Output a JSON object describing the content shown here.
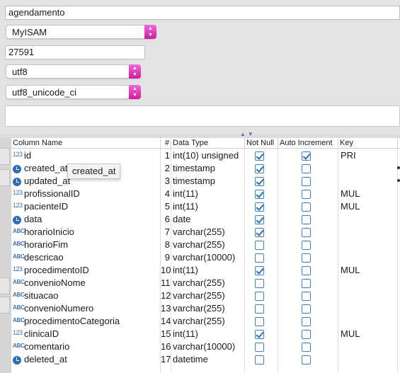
{
  "table_info": {
    "name": "agendamento",
    "engine": "MyISAM",
    "auto_increment": "27591",
    "encoding": "utf8",
    "collation": "utf8_unicode_ci",
    "comment": ""
  },
  "columns_header": {
    "column_name": "Column Name",
    "num": "#",
    "data_type": "Data Type",
    "not_null": "Not Null",
    "auto_increment": "Auto Increment",
    "key": "Key"
  },
  "rows": [
    {
      "icon": "numeric-icon",
      "name": "id",
      "num": "1",
      "type": "int(10) unsigned",
      "not_null": true,
      "auto_inc": true,
      "key": "PRI"
    },
    {
      "icon": "clock-icon",
      "name": "created_at",
      "num": "2",
      "type": "timestamp",
      "not_null": true,
      "auto_inc": false,
      "key": ""
    },
    {
      "icon": "clock-icon",
      "name": "updated_at",
      "num": "3",
      "type": "timestamp",
      "not_null": true,
      "auto_inc": false,
      "key": ""
    },
    {
      "icon": "numeric-icon",
      "name": "profissionalID",
      "num": "4",
      "type": "int(11)",
      "not_null": true,
      "auto_inc": false,
      "key": "MUL"
    },
    {
      "icon": "numeric-icon",
      "name": "pacienteID",
      "num": "5",
      "type": "int(11)",
      "not_null": true,
      "auto_inc": false,
      "key": "MUL"
    },
    {
      "icon": "clock-icon",
      "name": "data",
      "num": "6",
      "type": "date",
      "not_null": true,
      "auto_inc": false,
      "key": ""
    },
    {
      "icon": "text-icon",
      "name": "horarioInicio",
      "num": "7",
      "type": "varchar(255)",
      "not_null": true,
      "auto_inc": false,
      "key": ""
    },
    {
      "icon": "text-icon",
      "name": "horarioFim",
      "num": "8",
      "type": "varchar(255)",
      "not_null": false,
      "auto_inc": false,
      "key": ""
    },
    {
      "icon": "text-icon",
      "name": "descricao",
      "num": "9",
      "type": "varchar(10000)",
      "not_null": false,
      "auto_inc": false,
      "key": ""
    },
    {
      "icon": "numeric-icon",
      "name": "procedimentoID",
      "num": "10",
      "type": "int(11)",
      "not_null": true,
      "auto_inc": false,
      "key": "MUL"
    },
    {
      "icon": "text-icon",
      "name": "convenioNome",
      "num": "11",
      "type": "varchar(255)",
      "not_null": false,
      "auto_inc": false,
      "key": ""
    },
    {
      "icon": "text-icon",
      "name": "situacao",
      "num": "12",
      "type": "varchar(255)",
      "not_null": false,
      "auto_inc": false,
      "key": ""
    },
    {
      "icon": "text-icon",
      "name": "convenioNumero",
      "num": "13",
      "type": "varchar(255)",
      "not_null": false,
      "auto_inc": false,
      "key": ""
    },
    {
      "icon": "text-icon",
      "name": "procedimentoCategoria",
      "num": "14",
      "type": "varchar(255)",
      "not_null": false,
      "auto_inc": false,
      "key": ""
    },
    {
      "icon": "numeric-icon",
      "name": "clinicaID",
      "num": "15",
      "type": "int(11)",
      "not_null": true,
      "auto_inc": false,
      "key": "MUL"
    },
    {
      "icon": "text-icon",
      "name": "comentario",
      "num": "16",
      "type": "varchar(10000)",
      "not_null": false,
      "auto_inc": false,
      "key": ""
    },
    {
      "icon": "clock-icon",
      "name": "deleted_at",
      "num": "17",
      "type": "datetime",
      "not_null": false,
      "auto_inc": false,
      "key": ""
    }
  ],
  "icon_glyphs": {
    "numeric": "123",
    "text": "ABC"
  },
  "tooltip": "created_at",
  "colors": {
    "accent": "#3b82c4",
    "select_arrow": "#e23cc0"
  }
}
